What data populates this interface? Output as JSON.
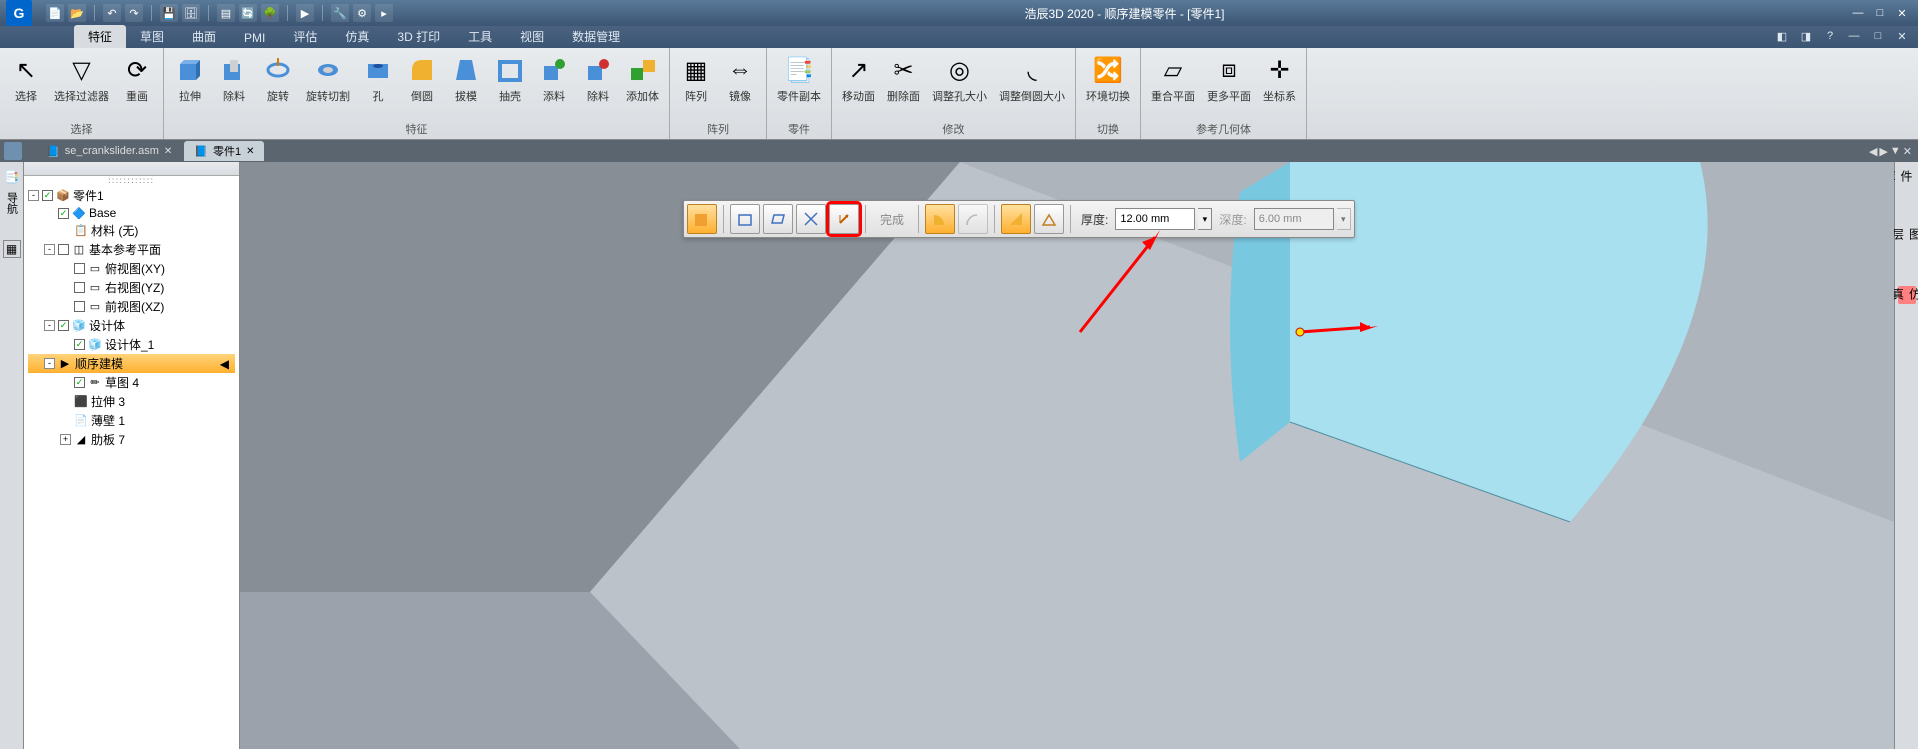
{
  "app": {
    "title": "浩辰3D 2020 - 顺序建模零件 - [零件1]",
    "logo": "G"
  },
  "ribbon": {
    "tabs": [
      "特征",
      "草图",
      "曲面",
      "PMI",
      "评估",
      "仿真",
      "3D 打印",
      "工具",
      "视图",
      "数据管理"
    ],
    "active_tab": "特征",
    "groups": {
      "select": {
        "title": "选择",
        "buttons": [
          {
            "label": "选择",
            "icon": "cursor"
          },
          {
            "label": "选择过滤器",
            "icon": "funnel"
          },
          {
            "label": "重画",
            "icon": "refresh"
          }
        ]
      },
      "feature": {
        "title": "特征",
        "buttons": [
          {
            "label": "拉伸",
            "icon": "extrude"
          },
          {
            "label": "除料",
            "icon": "cut"
          },
          {
            "label": "旋转",
            "icon": "revolve"
          },
          {
            "label": "旋转切割",
            "icon": "revcut"
          },
          {
            "label": "孔",
            "icon": "hole"
          },
          {
            "label": "倒圆",
            "icon": "fillet"
          },
          {
            "label": "拔模",
            "icon": "draft"
          },
          {
            "label": "抽壳",
            "icon": "shell"
          },
          {
            "label": "添料",
            "icon": "add"
          },
          {
            "label": "除料",
            "icon": "remove"
          },
          {
            "label": "添加体",
            "icon": "addbody"
          }
        ]
      },
      "array": {
        "title": "阵列",
        "buttons": [
          {
            "label": "阵列",
            "icon": "pattern"
          },
          {
            "label": "镜像",
            "icon": "mirror"
          }
        ]
      },
      "part": {
        "title": "零件",
        "buttons": [
          {
            "label": "零件副本",
            "icon": "partcopy"
          }
        ]
      },
      "modify": {
        "title": "修改",
        "buttons": [
          {
            "label": "移动面",
            "icon": "moveface"
          },
          {
            "label": "删除面",
            "icon": "delface"
          },
          {
            "label": "调整孔大小",
            "icon": "resizehole"
          },
          {
            "label": "调整倒圆大小",
            "icon": "resizefillet"
          }
        ]
      },
      "switch": {
        "title": "切换",
        "buttons": [
          {
            "label": "环境切换",
            "icon": "env"
          }
        ]
      },
      "refgeom": {
        "title": "参考几何体",
        "buttons": [
          {
            "label": "重合平面",
            "icon": "coplane"
          },
          {
            "label": "更多平面",
            "icon": "moreplane"
          },
          {
            "label": "坐标系",
            "icon": "csys"
          }
        ]
      }
    }
  },
  "doc_tabs": [
    {
      "label": "se_crankslider.asm",
      "active": false
    },
    {
      "label": "零件1",
      "active": true
    }
  ],
  "tree": {
    "root": "零件1",
    "items": [
      {
        "lv": 1,
        "toggle": "-",
        "chk": true,
        "icon": "📦",
        "label": "零件1"
      },
      {
        "lv": 2,
        "chk": true,
        "icon": "🔷",
        "label": "Base"
      },
      {
        "lv": 3,
        "icon": "📋",
        "label": "材料 (无)"
      },
      {
        "lv": 2,
        "toggle": "-",
        "chk": false,
        "icon": "◫",
        "label": "基本参考平面"
      },
      {
        "lv": 3,
        "chk": false,
        "icon": "▭",
        "label": "俯视图(XY)"
      },
      {
        "lv": 3,
        "chk": false,
        "icon": "▭",
        "label": "右视图(YZ)"
      },
      {
        "lv": 3,
        "chk": false,
        "icon": "▭",
        "label": "前视图(XZ)"
      },
      {
        "lv": 2,
        "toggle": "-",
        "chk": true,
        "icon": "🧊",
        "label": "设计体"
      },
      {
        "lv": 3,
        "chk": true,
        "icon": "🧊",
        "label": "设计体_1"
      },
      {
        "lv": 2,
        "toggle": "-",
        "sel": true,
        "icon": "▶",
        "label": "顺序建模"
      },
      {
        "lv": 3,
        "chk": true,
        "icon": "✏",
        "label": "草图 4"
      },
      {
        "lv": 3,
        "icon": "⬛",
        "label": "拉伸 3"
      },
      {
        "lv": 3,
        "icon": "📄",
        "label": "薄壁 1"
      },
      {
        "lv": 3,
        "toggle": "+",
        "icon": "◢",
        "label": "肋板 7"
      }
    ]
  },
  "cmdbar": {
    "finish_label": "完成",
    "thickness_label": "厚度:",
    "thickness_value": "12.00 mm",
    "depth_label": "深度:",
    "depth_value": "6.00 mm",
    "buttons": [
      {
        "name": "preview",
        "on": true
      },
      {
        "name": "step-plane"
      },
      {
        "name": "step-sketch"
      },
      {
        "name": "step-axis"
      },
      {
        "name": "step-direction",
        "hl": true
      }
    ],
    "angle_buttons": [
      {
        "name": "angle1",
        "on": true
      },
      {
        "name": "angle2",
        "dis": true
      },
      {
        "name": "angle3",
        "on": true
      },
      {
        "name": "angle4"
      }
    ]
  },
  "right_strip": [
    "零件库",
    "图层",
    "仿真"
  ],
  "left_strip_label": "导航"
}
